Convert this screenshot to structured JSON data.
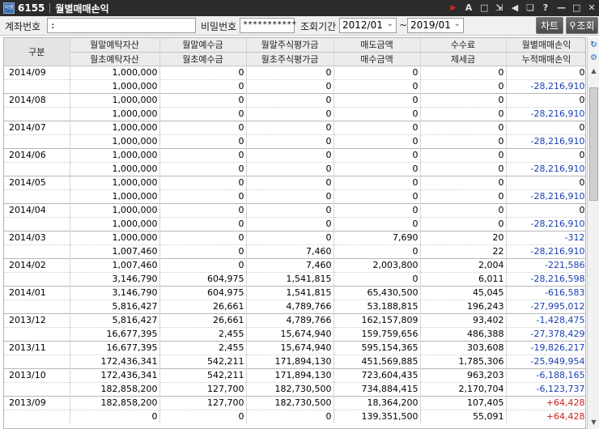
{
  "window": {
    "app_icon": "app-icon",
    "screen_code": "6155",
    "title": "월별매매손익",
    "controls": [
      "▶",
      "A",
      "⬚",
      "⬚",
      "◀",
      "⬚",
      "?",
      "_",
      "□",
      "X"
    ]
  },
  "search": {
    "account_label": "계좌번호",
    "account_value": ":",
    "password_label": "비밀번호",
    "password_value": "***********",
    "period_label": "조회기간",
    "period_from": "2012/01",
    "period_sep": "~",
    "period_to": "2019/01",
    "chart_button": "차트",
    "query_button": "조회"
  },
  "table": {
    "header_gubun": "구분",
    "header_row1": [
      "월말예탁자산",
      "월말예수금",
      "월말주식평가금",
      "매도금액",
      "수수료",
      "월별매매손익"
    ],
    "header_row2": [
      "월초예탁자산",
      "월초예수금",
      "월초주식평가금",
      "매수금액",
      "제세금",
      "누적매매손익"
    ],
    "rows": [
      {
        "period": "2014/09",
        "cells": [
          "1,000,000",
          "0",
          "0",
          "0",
          "0",
          "0"
        ],
        "tone": ""
      },
      {
        "period": "",
        "cells": [
          "1,000,000",
          "0",
          "0",
          "0",
          "0",
          "-28,216,910"
        ],
        "tone": "neg"
      },
      {
        "period": "2014/08",
        "cells": [
          "1,000,000",
          "0",
          "0",
          "0",
          "0",
          "0"
        ],
        "tone": ""
      },
      {
        "period": "",
        "cells": [
          "1,000,000",
          "0",
          "0",
          "0",
          "0",
          "-28,216,910"
        ],
        "tone": "neg"
      },
      {
        "period": "2014/07",
        "cells": [
          "1,000,000",
          "0",
          "0",
          "0",
          "0",
          "0"
        ],
        "tone": ""
      },
      {
        "period": "",
        "cells": [
          "1,000,000",
          "0",
          "0",
          "0",
          "0",
          "-28,216,910"
        ],
        "tone": "neg"
      },
      {
        "period": "2014/06",
        "cells": [
          "1,000,000",
          "0",
          "0",
          "0",
          "0",
          "0"
        ],
        "tone": ""
      },
      {
        "period": "",
        "cells": [
          "1,000,000",
          "0",
          "0",
          "0",
          "0",
          "-28,216,910"
        ],
        "tone": "neg"
      },
      {
        "period": "2014/05",
        "cells": [
          "1,000,000",
          "0",
          "0",
          "0",
          "0",
          "0"
        ],
        "tone": ""
      },
      {
        "period": "",
        "cells": [
          "1,000,000",
          "0",
          "0",
          "0",
          "0",
          "-28,216,910"
        ],
        "tone": "neg"
      },
      {
        "period": "2014/04",
        "cells": [
          "1,000,000",
          "0",
          "0",
          "0",
          "0",
          "0"
        ],
        "tone": ""
      },
      {
        "period": "",
        "cells": [
          "1,000,000",
          "0",
          "0",
          "0",
          "0",
          "-28,216,910"
        ],
        "tone": "neg"
      },
      {
        "period": "2014/03",
        "cells": [
          "1,000,000",
          "0",
          "0",
          "7,690",
          "20",
          "-312"
        ],
        "tone": "neg"
      },
      {
        "period": "",
        "cells": [
          "1,007,460",
          "0",
          "7,460",
          "0",
          "22",
          "-28,216,910"
        ],
        "tone": "neg"
      },
      {
        "period": "2014/02",
        "cells": [
          "1,007,460",
          "0",
          "7,460",
          "2,003,800",
          "2,004",
          "-221,586"
        ],
        "tone": "neg"
      },
      {
        "period": "",
        "cells": [
          "3,146,790",
          "604,975",
          "1,541,815",
          "0",
          "6,011",
          "-28,216,598"
        ],
        "tone": "neg"
      },
      {
        "period": "2014/01",
        "cells": [
          "3,146,790",
          "604,975",
          "1,541,815",
          "65,430,500",
          "45,045",
          "-616,583"
        ],
        "tone": "neg"
      },
      {
        "period": "",
        "cells": [
          "5,816,427",
          "26,661",
          "4,789,766",
          "53,188,815",
          "196,243",
          "-27,995,012"
        ],
        "tone": "neg"
      },
      {
        "period": "2013/12",
        "cells": [
          "5,816,427",
          "26,661",
          "4,789,766",
          "162,157,809",
          "93,402",
          "-1,428,475"
        ],
        "tone": "neg"
      },
      {
        "period": "",
        "cells": [
          "16,677,395",
          "2,455",
          "15,674,940",
          "159,759,656",
          "486,388",
          "-27,378,429"
        ],
        "tone": "neg"
      },
      {
        "period": "2013/11",
        "cells": [
          "16,677,395",
          "2,455",
          "15,674,940",
          "595,154,365",
          "303,608",
          "-19,826,217"
        ],
        "tone": "neg"
      },
      {
        "period": "",
        "cells": [
          "172,436,341",
          "542,211",
          "171,894,130",
          "451,569,885",
          "1,785,306",
          "-25,949,954"
        ],
        "tone": "neg"
      },
      {
        "period": "2013/10",
        "cells": [
          "172,436,341",
          "542,211",
          "171,894,130",
          "723,604,435",
          "963,203",
          "-6,188,165"
        ],
        "tone": "neg"
      },
      {
        "period": "",
        "cells": [
          "182,858,200",
          "127,700",
          "182,730,500",
          "734,884,415",
          "2,170,704",
          "-6,123,737"
        ],
        "tone": "neg"
      },
      {
        "period": "2013/09",
        "cells": [
          "182,858,200",
          "127,700",
          "182,730,500",
          "18,364,200",
          "107,405",
          "+64,428"
        ],
        "tone": "pos"
      },
      {
        "period": "",
        "cells": [
          "0",
          "0",
          "0",
          "139,351,500",
          "55,091",
          "+64,428"
        ],
        "tone": "pos"
      }
    ]
  },
  "colors": {
    "negative": "#1a3fb3",
    "positive": "#d02020",
    "titlebar": "#2b2b2b"
  }
}
